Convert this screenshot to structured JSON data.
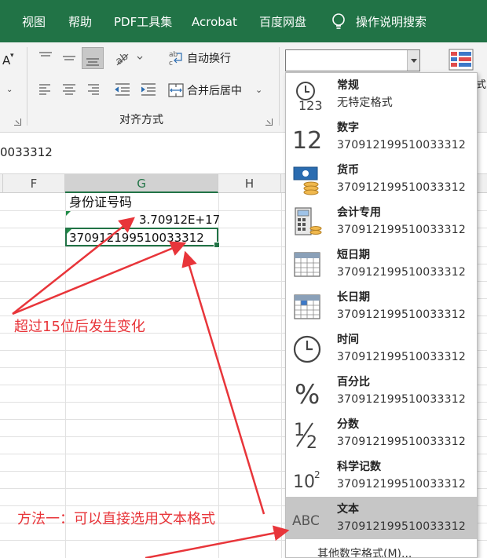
{
  "tabs": [
    "视图",
    "帮助",
    "PDF工具集",
    "Acrobat",
    "百度网盘",
    "操作说明搜索"
  ],
  "ribbon": {
    "font_size_letter": "A",
    "wrap_text": "自动换行",
    "merge_center": "合并后居中",
    "alignment_group": "对齐方式",
    "number_format_value": "",
    "right_cut_label": "式"
  },
  "formula_bar": {
    "value": "0033312"
  },
  "sheet": {
    "columns": [
      "F",
      "G",
      "H"
    ],
    "selected_column": "G",
    "cells": {
      "g_header": "身份证号码",
      "g_sci": "3.70912E+17",
      "g_text": "370912199510033312"
    }
  },
  "annotations": {
    "note1": "超过15位后发生变化",
    "note2": "方法一：可以直接选用文本格式"
  },
  "number_formats": [
    {
      "name": "常规",
      "sample": "无特定格式",
      "icon": "general-clock-123-icon"
    },
    {
      "name": "数字",
      "sample": "370912199510033312",
      "icon": "number-12-icon"
    },
    {
      "name": "货币",
      "sample": "370912199510033312",
      "icon": "currency-icon"
    },
    {
      "name": "会计专用",
      "sample": " 370912199510033312",
      "icon": "accounting-icon"
    },
    {
      "name": "短日期",
      "sample": "370912199510033312",
      "icon": "short-date-calendar-icon"
    },
    {
      "name": "长日期",
      "sample": "370912199510033312",
      "icon": "long-date-calendar-icon"
    },
    {
      "name": "时间",
      "sample": "370912199510033312",
      "icon": "time-clock-icon"
    },
    {
      "name": "百分比",
      "sample": "370912199510033312",
      "icon": "percent-icon"
    },
    {
      "name": "分数",
      "sample": "370912199510033312",
      "icon": "fraction-icon"
    },
    {
      "name": "科学记数",
      "sample": "370912199510033312",
      "icon": "scientific-icon"
    },
    {
      "name": "文本",
      "sample": "370912199510033312",
      "icon": "text-abc-icon",
      "selected": true
    }
  ],
  "more_formats": "其他数字格式(M)...",
  "colors": {
    "excel_green": "#217346",
    "annotation_red": "#e8353a",
    "selected_row": "#c6c6c6"
  }
}
